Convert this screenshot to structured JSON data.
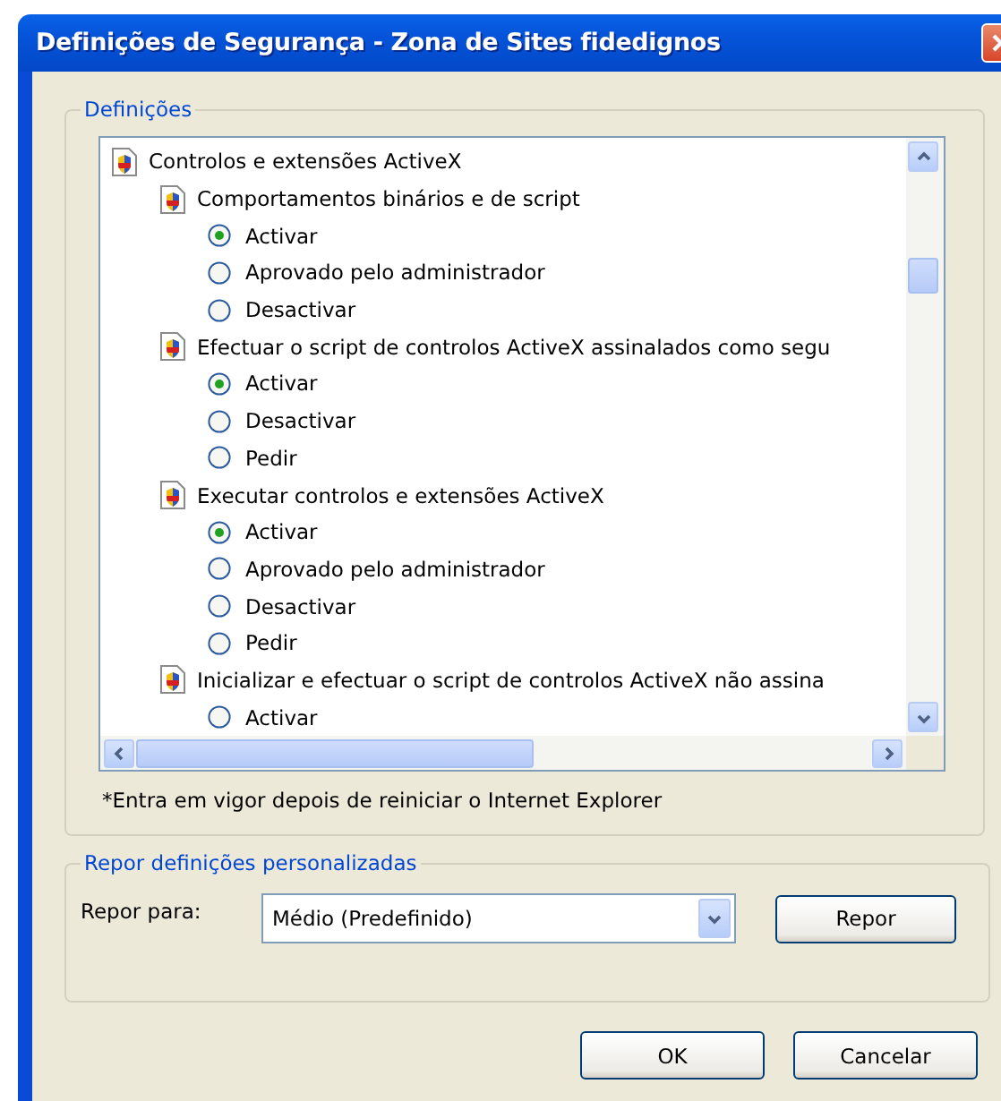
{
  "window": {
    "title": "Definições de Segurança - Zona de Sites fidedignos"
  },
  "settings_group": {
    "legend": "Definições",
    "tree": {
      "label": "Controlos e extensões ActiveX",
      "kind": "category",
      "children": [
        {
          "label": "Comportamentos binários e de script",
          "kind": "setting",
          "children": [
            {
              "label": "Activar",
              "kind": "option",
              "selected": true
            },
            {
              "label": "Aprovado pelo administrador",
              "kind": "option",
              "selected": false
            },
            {
              "label": "Desactivar",
              "kind": "option",
              "selected": false
            }
          ]
        },
        {
          "label": "Efectuar o script de controlos ActiveX assinalados como segu",
          "kind": "setting",
          "children": [
            {
              "label": "Activar",
              "kind": "option",
              "selected": true
            },
            {
              "label": "Desactivar",
              "kind": "option",
              "selected": false
            },
            {
              "label": "Pedir",
              "kind": "option",
              "selected": false
            }
          ]
        },
        {
          "label": "Executar controlos e extensões ActiveX",
          "kind": "setting",
          "children": [
            {
              "label": "Activar",
              "kind": "option",
              "selected": true
            },
            {
              "label": "Aprovado pelo administrador",
              "kind": "option",
              "selected": false
            },
            {
              "label": "Desactivar",
              "kind": "option",
              "selected": false
            },
            {
              "label": "Pedir",
              "kind": "option",
              "selected": false
            }
          ]
        },
        {
          "label": "Inicializar e efectuar o script de controlos ActiveX não assina",
          "kind": "setting",
          "children": [
            {
              "label": "Activar",
              "kind": "option",
              "selected": false
            }
          ]
        }
      ]
    },
    "note": "*Entra em vigor depois de reiniciar o Internet Explorer"
  },
  "reset_group": {
    "legend": "Repor definições personalizadas",
    "label": "Repor para:",
    "select": {
      "value": "Médio (Predefinido)"
    },
    "button": "Repor"
  },
  "buttons": [
    "OK",
    "Cancelar"
  ]
}
